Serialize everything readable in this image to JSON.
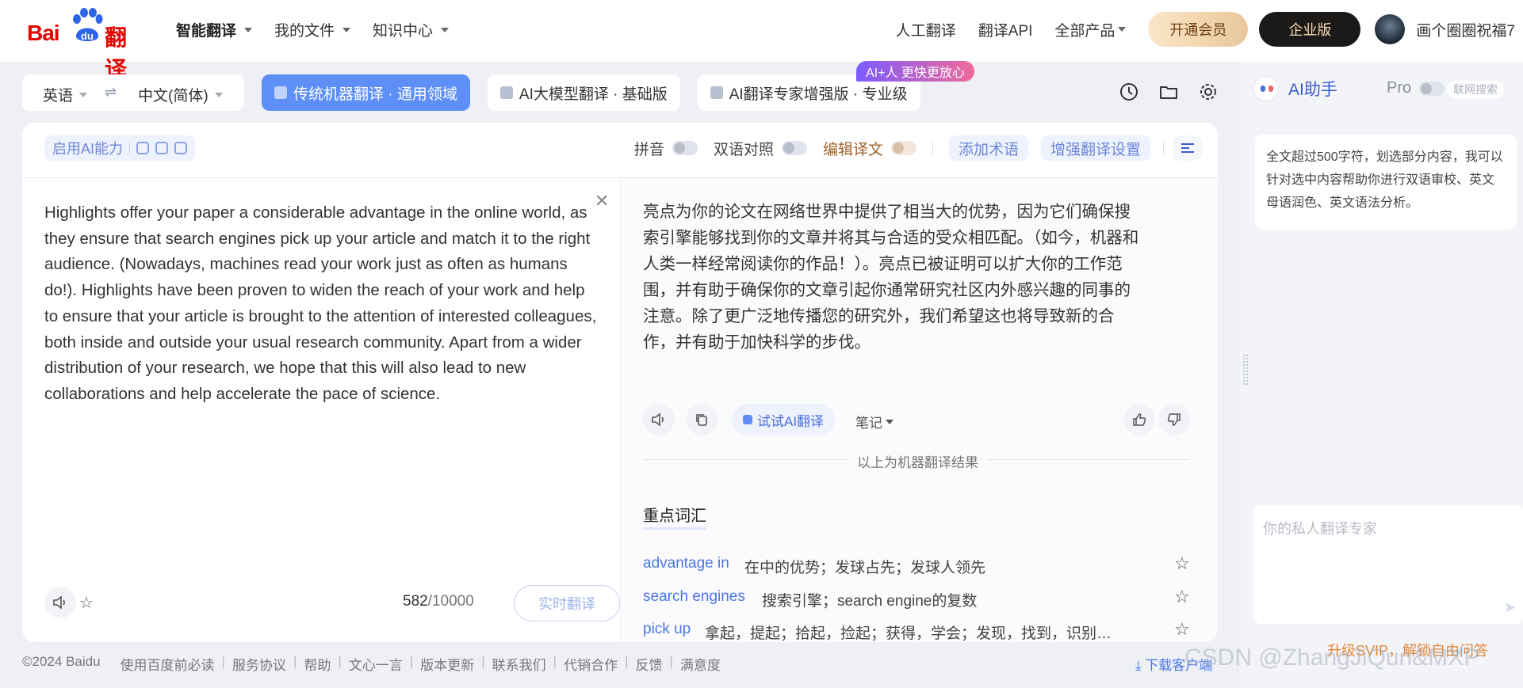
{
  "brand": {
    "logo_text_left": "Bai",
    "logo_text_mid": "du",
    "logo_text_right": "翻译",
    "accent": "#e10601"
  },
  "topnav": [
    {
      "label": "智能翻译"
    },
    {
      "label": "我的文件"
    },
    {
      "label": "知识中心"
    }
  ],
  "rightnav": {
    "human": "人工翻译",
    "api": "翻译API",
    "products": "全部产品",
    "vip": "开通会员",
    "enterprise": "企业版",
    "user": "画个圈圈祝福7"
  },
  "lang": {
    "source": "英语",
    "target": "中文(简体)",
    "swap_icon": "⇌"
  },
  "modes": [
    {
      "label": "传统机器翻译 · 通用领域"
    },
    {
      "label": "AI大模型翻译 · 基础版"
    },
    {
      "label": "AI翻译专家增强版 · 专业级"
    }
  ],
  "promo": "AI+人 更快更放心",
  "toolbar": {
    "ai_ability": "启用AI能力",
    "pinyin": "拼音",
    "bilingual": "双语对照",
    "edit": "编辑译文",
    "add_term": "添加术语",
    "enhance": "增强翻译设置"
  },
  "source": {
    "text": "Highlights offer your paper a considerable advantage in the online world, as they ensure that search engines pick up your article and match it to the right audience. (Nowadays, machines read your work just as often as humans do!). Highlights have been proven to widen the reach of your work and help to ensure that your article is brought to the attention of interested colleagues, both inside and outside your usual research community. Apart from a wider distribution of your research, we hope that this will also lead to new collaborations and help accelerate the pace of science.",
    "count": "582",
    "max": "/10000",
    "realtime": "实时翻译"
  },
  "target": {
    "text": "亮点为你的论文在网络世界中提供了相当大的优势，因为它们确保搜索引擎能够找到你的文章并将其与合适的受众相匹配。（如今，机器和人类一样经常阅读你的作品！）。亮点已被证明可以扩大你的工作范围，并有助于确保你的文章引起你通常研究社区内外感兴趣的同事的注意。除了更广泛地传播您的研究外，我们希望这也将导致新的合作，并有助于加快科学的步伐。",
    "try_ai": "试试AI翻译",
    "notes": "笔记",
    "machine_note": "以上为机器翻译结果"
  },
  "keywords": {
    "title": "重点词汇",
    "items": [
      {
        "word": "advantage in",
        "def": "在中的优势；发球占先；发球人领先"
      },
      {
        "word": "search engines",
        "def": "搜索引擎；search engine的复数"
      },
      {
        "word": "pick up",
        "def": "拿起，提起；拾起，捡起；获得，学会；发现，找到，识别；得，…"
      }
    ]
  },
  "footer": {
    "items": [
      "©2024 Baidu",
      "使用百度前必读",
      "服务协议",
      "帮助",
      "文心一言",
      "版本更新",
      "联系我们",
      "代销合作",
      "反馈",
      "满意度"
    ],
    "download": "下载客户端"
  },
  "assistant": {
    "title": "AI助手",
    "pro": "Pro",
    "net": "联网搜索",
    "message": "全文超过500字符，划选部分内容，我可以针对选中内容帮助你进行双语审校、英文母语润色、英文语法分析。",
    "placeholder": "你的私人翻译专家",
    "upgrade": "升级SVIP，解锁自由问答"
  },
  "watermark": "CSDN @ZhangJiQun&MXP"
}
